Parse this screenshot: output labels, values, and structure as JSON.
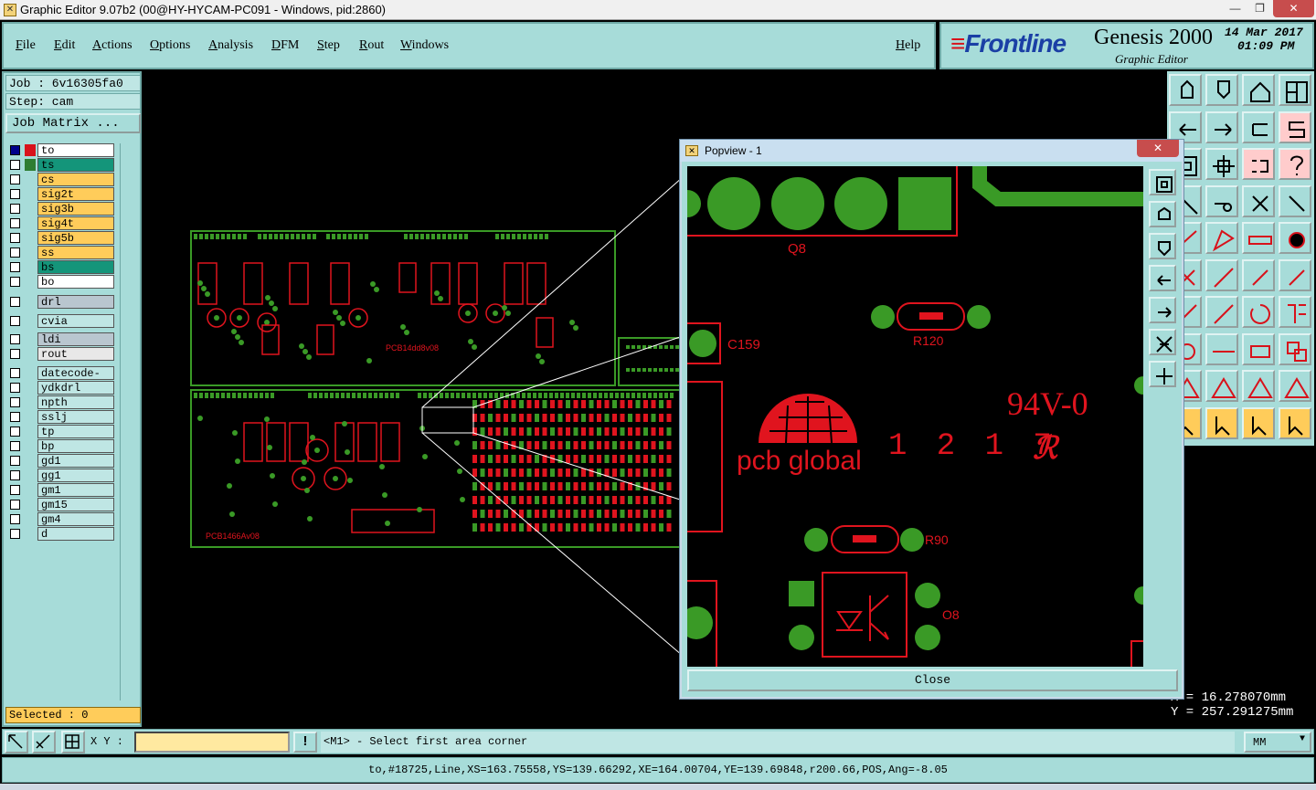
{
  "window": {
    "title": "Graphic Editor 9.07b2 (00@HY-HYCAM-PC091 - Windows, pid:2860)",
    "min_glyph": "—",
    "max_glyph": "❐",
    "close_glyph": "✕"
  },
  "menu": {
    "items": [
      "File",
      "Edit",
      "Actions",
      "Options",
      "Analysis",
      "DFM",
      "Step",
      "Rout",
      "Windows"
    ],
    "help": "Help"
  },
  "logo": {
    "brand": "Frontline",
    "product": "Genesis 2000",
    "subtitle": "Graphic Editor",
    "date": "14 Mar 2017",
    "time": "01:09 PM"
  },
  "left_panel": {
    "job": "Job : 6v16305fa0",
    "step": "Step: cam",
    "job_matrix": "Job Matrix ...",
    "selected": "Selected : 0"
  },
  "layers": [
    {
      "name": "to",
      "color": "#ffffff",
      "box": "#00008b"
    },
    {
      "name": "ts",
      "color": "#14957a",
      "box": "#2e7d32"
    },
    {
      "name": "cs",
      "color": "#ffcc5a"
    },
    {
      "name": "sig2t",
      "color": "#ffcc5a"
    },
    {
      "name": "sig3b",
      "color": "#ffcc5a"
    },
    {
      "name": "sig4t",
      "color": "#ffcc5a"
    },
    {
      "name": "sig5b",
      "color": "#ffcc5a"
    },
    {
      "name": "ss",
      "color": "#ffcc5a"
    },
    {
      "name": "bs",
      "color": "#14957a"
    },
    {
      "name": "bo",
      "color": "#ffffff"
    },
    {
      "name": "drl",
      "color": "#b9c6cf"
    },
    {
      "name": "cvia",
      "color": "#bfe6e4"
    },
    {
      "name": "ldi",
      "color": "#b9c6cf"
    },
    {
      "name": "rout",
      "color": "#e8e8e8"
    },
    {
      "name": "datecode-to",
      "color": "#bfe6e4"
    },
    {
      "name": "ydkdrl",
      "color": "#bfe6e4"
    },
    {
      "name": "npth",
      "color": "#bfe6e4"
    },
    {
      "name": "sslj",
      "color": "#bfe6e4"
    },
    {
      "name": "tp",
      "color": "#bfe6e4"
    },
    {
      "name": "bp",
      "color": "#bfe6e4"
    },
    {
      "name": "gd1",
      "color": "#bfe6e4"
    },
    {
      "name": "gg1",
      "color": "#bfe6e4"
    },
    {
      "name": "gm1",
      "color": "#bfe6e4"
    },
    {
      "name": "gm15",
      "color": "#bfe6e4"
    },
    {
      "name": "gm4",
      "color": "#bfe6e4"
    },
    {
      "name": "d",
      "color": "#bfe6e4"
    }
  ],
  "pcb": {
    "board1_label": "PCB14dd8v08",
    "board2_label": "PCB1466Av08",
    "trace_color": "#e0141e",
    "pad_color": "#3a9a26"
  },
  "popview": {
    "title": "Popview - 1",
    "close_label": "Close",
    "labels": {
      "q8": "Q8",
      "r120": "R120",
      "c159": "C159",
      "rating": "94V-0",
      "pcb_global": "pcb global",
      "date_code": "1 2 1 7",
      "r90": "R90",
      "o8": "O8"
    }
  },
  "coords": {
    "x": "X = 16.278070mm",
    "y": "Y = 257.291275mm"
  },
  "command": {
    "xy_label": "X Y :",
    "xy_value": "",
    "warn": "!",
    "prompt": "<M1> - Select first area corner",
    "unit": "MM",
    "unit_arrow": "▼"
  },
  "status": "to,#18725,Line,XS=163.75558,YS=139.66292,XE=164.00704,YE=139.69848,r200.66,POS,Ang=-8.05",
  "icons": {
    "accent": "#a7dcd9",
    "brand_blue": "#1a3fa5",
    "brand_red": "#d8121b"
  }
}
